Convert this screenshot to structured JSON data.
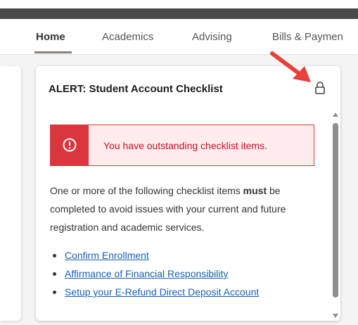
{
  "nav": {
    "tabs": [
      {
        "label": "Home",
        "active": true
      },
      {
        "label": "Academics"
      },
      {
        "label": "Advising"
      },
      {
        "label": "Bills & Paymen"
      }
    ]
  },
  "card": {
    "title": "ALERT: Student Account Checklist",
    "lock_icon": "lock-icon",
    "alert": {
      "icon": "exclamation-circle-icon",
      "message": "You have outstanding checklist items."
    },
    "body_pre": "One or more of the following checklist items ",
    "body_bold": "must",
    "body_post": " be completed to avoid issues with your current and future registration and academic services.",
    "links": [
      "Confirm Enrollment",
      "Affirmance of Financial Responsibility",
      "Setup your E-Refund Direct Deposit Account"
    ]
  },
  "colors": {
    "topbar": "#4a4a4a",
    "alert_red": "#d9363e",
    "alert_bg": "#fdeceb",
    "link_blue": "#1a5fb4",
    "arrow": "#e8403a"
  }
}
